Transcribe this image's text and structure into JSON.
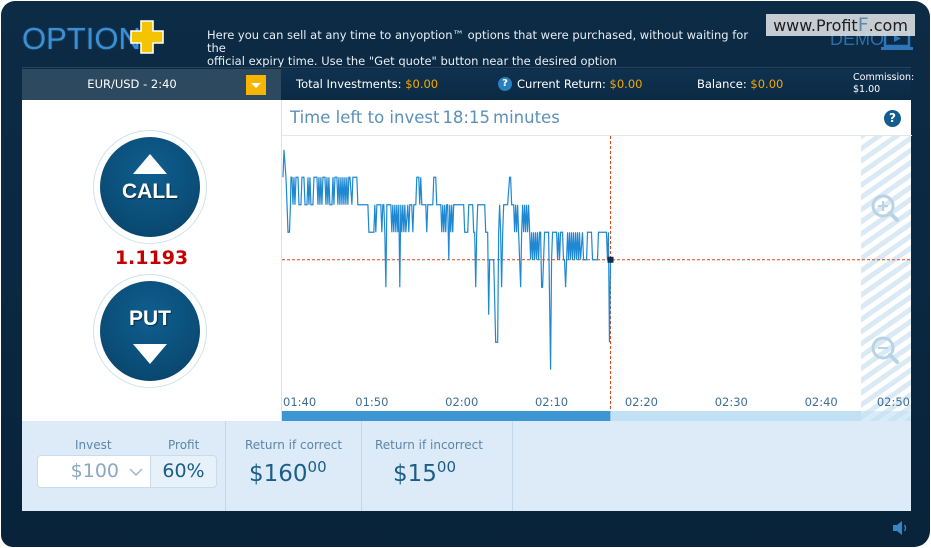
{
  "header": {
    "logo_text": "OPTION",
    "logo_icon": "plus-icon",
    "info_text_line1": "Here you can sell at any time to anyoption™ options that were purchased, without waiting for the",
    "info_text_line2": "official expiry time. Use the \"Get quote\" button near the desired option",
    "watermark_prefix": "www.Profit",
    "watermark_f": "F",
    "watermark_suffix": ".com",
    "demo_label": "DEMO",
    "demo_icon": "laptop-play-icon"
  },
  "toolbar": {
    "asset": "EUR/USD - 2:40",
    "asset_dropdown_icon": "chevron-down-icon",
    "total_investments_label": "Total Investments:",
    "total_investments_value": "$0.00",
    "current_return_help": "?",
    "current_return_label": "Current Return:",
    "current_return_value": "$0.00",
    "balance_label": "Balance:",
    "balance_value": "$0.00",
    "commission_label": "Commission:",
    "commission_value": "$1.00"
  },
  "trade": {
    "call_label": "CALL",
    "put_label": "PUT",
    "current_price": "1.1193"
  },
  "chart_panel": {
    "title_prefix": "Time left to invest",
    "time_left": "18:15",
    "title_suffix": "minutes",
    "help": "?",
    "zoom_in_icon": "zoom-in-icon",
    "zoom_out_icon": "zoom-out-icon"
  },
  "bottom": {
    "invest_label": "Invest",
    "profit_label": "Profit",
    "invest_value": "$100",
    "profit_value": "60%",
    "return_correct_label": "Return if correct",
    "return_correct_main": "$160",
    "return_correct_cents": "00",
    "return_incorrect_label": "Return if incorrect",
    "return_incorrect_main": "$15",
    "return_incorrect_cents": "00"
  },
  "footer": {
    "sound_icon": "speaker-icon"
  },
  "colors": {
    "frame": "#0b2a44",
    "accent_yellow": "#f7b400",
    "value_orange": "#f7a800",
    "price_red": "#c40000",
    "line_blue": "#1f88d2",
    "marker_red": "#d9441c",
    "progress_fill": "#3d96d3",
    "progress_rest": "#c2e0f4"
  },
  "chart_data": {
    "type": "line",
    "title": "Time left to invest 18:15 minutes",
    "xlabel": "",
    "ylabel": "",
    "x_unit": "minutes since 01:40",
    "xlim": [
      0,
      70
    ],
    "ylim": [
      1.11875,
      1.11975
    ],
    "grid": false,
    "x_ticks": [
      {
        "x": 0,
        "label": "01:40"
      },
      {
        "x": 10,
        "label": "01:50"
      },
      {
        "x": 20,
        "label": "02:00"
      },
      {
        "x": 30,
        "label": "02:10"
      },
      {
        "x": 40,
        "label": "02:20"
      },
      {
        "x": 50,
        "label": "02:30"
      },
      {
        "x": 60,
        "label": "02:40"
      },
      {
        "x": 70,
        "label": "02:50"
      }
    ],
    "current_time_x": 36.56,
    "current_price": 1.1193,
    "closed_zone_from_x": 64.44,
    "elapsed_fraction": 0.522,
    "series": [
      {
        "name": "EUR/USD",
        "points": [
          [
            0.11,
            1.1196
          ],
          [
            0.22,
            1.1197
          ],
          [
            0.44,
            1.1196
          ],
          [
            0.56,
            1.1195
          ],
          [
            0.67,
            1.1194
          ],
          [
            0.83,
            1.1194
          ],
          [
            0.94,
            1.1195
          ],
          [
            1.0,
            1.1196
          ],
          [
            1.11,
            1.1196
          ],
          [
            1.22,
            1.1195
          ],
          [
            1.33,
            1.1196
          ],
          [
            1.44,
            1.1195
          ],
          [
            1.56,
            1.1196
          ],
          [
            1.78,
            1.1196
          ],
          [
            1.89,
            1.1195
          ],
          [
            2.11,
            1.1195
          ],
          [
            2.22,
            1.1196
          ],
          [
            2.44,
            1.1196
          ],
          [
            2.56,
            1.1195
          ],
          [
            2.78,
            1.1195
          ],
          [
            2.89,
            1.1196
          ],
          [
            3.0,
            1.1195
          ],
          [
            3.11,
            1.1196
          ],
          [
            3.22,
            1.1195
          ],
          [
            3.44,
            1.1195
          ],
          [
            3.56,
            1.1196
          ],
          [
            3.89,
            1.1196
          ],
          [
            4.0,
            1.1195
          ],
          [
            4.11,
            1.1196
          ],
          [
            4.22,
            1.1195
          ],
          [
            4.33,
            1.1196
          ],
          [
            4.44,
            1.1195
          ],
          [
            4.56,
            1.1196
          ],
          [
            4.78,
            1.1196
          ],
          [
            4.89,
            1.1195
          ],
          [
            5.0,
            1.1196
          ],
          [
            5.11,
            1.1195
          ],
          [
            5.22,
            1.1196
          ],
          [
            5.33,
            1.1195
          ],
          [
            5.56,
            1.1195
          ],
          [
            5.67,
            1.1196
          ],
          [
            5.78,
            1.1195
          ],
          [
            5.89,
            1.1196
          ],
          [
            6.11,
            1.1196
          ],
          [
            6.22,
            1.1195
          ],
          [
            6.33,
            1.1196
          ],
          [
            6.44,
            1.1195
          ],
          [
            6.56,
            1.1196
          ],
          [
            6.67,
            1.1195
          ],
          [
            6.78,
            1.1196
          ],
          [
            6.89,
            1.1195
          ],
          [
            7.0,
            1.1196
          ],
          [
            7.11,
            1.1195
          ],
          [
            7.22,
            1.1196
          ],
          [
            7.33,
            1.1195
          ],
          [
            7.44,
            1.1196
          ],
          [
            7.56,
            1.1196
          ],
          [
            7.78,
            1.1195
          ],
          [
            7.89,
            1.1196
          ],
          [
            8.0,
            1.1196
          ],
          [
            8.33,
            1.1196
          ],
          [
            8.44,
            1.1195
          ],
          [
            9.56,
            1.1195
          ],
          [
            9.67,
            1.1194
          ],
          [
            10.22,
            1.1194
          ],
          [
            10.33,
            1.1195
          ],
          [
            10.44,
            1.1194
          ],
          [
            10.56,
            1.1195
          ],
          [
            10.67,
            1.1195
          ],
          [
            11.0,
            1.1195
          ],
          [
            11.11,
            1.1194
          ],
          [
            11.22,
            1.1195
          ],
          [
            11.33,
            1.1195
          ],
          [
            11.44,
            1.1194
          ],
          [
            11.56,
            1.1192
          ],
          [
            11.67,
            1.1195
          ],
          [
            12.11,
            1.1195
          ],
          [
            12.22,
            1.1194
          ],
          [
            12.33,
            1.1195
          ],
          [
            12.44,
            1.1194
          ],
          [
            12.56,
            1.1195
          ],
          [
            12.67,
            1.1194
          ],
          [
            12.78,
            1.1195
          ],
          [
            12.89,
            1.1194
          ],
          [
            13.0,
            1.1195
          ],
          [
            13.11,
            1.1192
          ],
          [
            13.22,
            1.1195
          ],
          [
            13.33,
            1.1194
          ],
          [
            13.44,
            1.1195
          ],
          [
            13.56,
            1.1194
          ],
          [
            13.67,
            1.1195
          ],
          [
            13.78,
            1.1194
          ],
          [
            14.0,
            1.1195
          ],
          [
            14.11,
            1.1194
          ],
          [
            14.22,
            1.1195
          ],
          [
            14.44,
            1.1195
          ],
          [
            14.56,
            1.1194
          ],
          [
            14.67,
            1.1195
          ],
          [
            14.89,
            1.1195
          ],
          [
            15.0,
            1.1196
          ],
          [
            15.22,
            1.1196
          ],
          [
            15.33,
            1.1195
          ],
          [
            15.44,
            1.1196
          ],
          [
            15.56,
            1.1195
          ],
          [
            16.0,
            1.1195
          ],
          [
            16.11,
            1.1194
          ],
          [
            16.22,
            1.1195
          ],
          [
            16.78,
            1.1195
          ],
          [
            16.89,
            1.1196
          ],
          [
            17.11,
            1.1196
          ],
          [
            17.22,
            1.1195
          ],
          [
            17.67,
            1.1195
          ],
          [
            17.78,
            1.1194
          ],
          [
            17.89,
            1.1195
          ],
          [
            18.0,
            1.1194
          ],
          [
            18.11,
            1.1195
          ],
          [
            18.22,
            1.1194
          ],
          [
            18.33,
            1.1195
          ],
          [
            18.44,
            1.1195
          ],
          [
            18.56,
            1.1193
          ],
          [
            18.67,
            1.1195
          ],
          [
            18.78,
            1.1194
          ],
          [
            18.89,
            1.1195
          ],
          [
            19.0,
            1.1194
          ],
          [
            19.11,
            1.1195
          ],
          [
            20.22,
            1.1195
          ],
          [
            20.33,
            1.1194
          ],
          [
            20.67,
            1.1194
          ],
          [
            20.78,
            1.1195
          ],
          [
            21.22,
            1.1195
          ],
          [
            21.33,
            1.1194
          ],
          [
            21.44,
            1.1194
          ],
          [
            21.56,
            1.1192
          ],
          [
            21.67,
            1.1194
          ],
          [
            21.78,
            1.1195
          ],
          [
            22.56,
            1.1195
          ],
          [
            22.67,
            1.1194
          ],
          [
            22.89,
            1.1194
          ],
          [
            23.0,
            1.1191
          ],
          [
            23.11,
            1.1193
          ],
          [
            23.56,
            1.1193
          ],
          [
            23.78,
            1.119
          ],
          [
            24.0,
            1.119
          ],
          [
            24.11,
            1.1194
          ],
          [
            24.22,
            1.1195
          ],
          [
            24.33,
            1.1194
          ],
          [
            24.44,
            1.1192
          ],
          [
            24.56,
            1.1194
          ],
          [
            24.67,
            1.1195
          ],
          [
            25.11,
            1.1195
          ],
          [
            25.33,
            1.1196
          ],
          [
            25.44,
            1.1196
          ],
          [
            25.56,
            1.1195
          ],
          [
            25.78,
            1.1195
          ],
          [
            25.89,
            1.1194
          ],
          [
            26.0,
            1.1195
          ],
          [
            26.11,
            1.1194
          ],
          [
            26.22,
            1.1195
          ],
          [
            26.33,
            1.1194
          ],
          [
            26.56,
            1.1192
          ],
          [
            26.67,
            1.1194
          ],
          [
            26.78,
            1.1195
          ],
          [
            26.89,
            1.1194
          ],
          [
            27.0,
            1.1195
          ],
          [
            27.11,
            1.1194
          ],
          [
            27.22,
            1.1195
          ],
          [
            27.33,
            1.1194
          ],
          [
            27.44,
            1.1195
          ],
          [
            27.56,
            1.1194
          ],
          [
            27.67,
            1.1193
          ],
          [
            27.78,
            1.1194
          ],
          [
            27.89,
            1.1193
          ],
          [
            28.0,
            1.1194
          ],
          [
            28.11,
            1.1193
          ],
          [
            28.22,
            1.1194
          ],
          [
            28.33,
            1.1193
          ],
          [
            28.44,
            1.1194
          ],
          [
            28.56,
            1.1193
          ],
          [
            28.67,
            1.1194
          ],
          [
            28.78,
            1.1194
          ],
          [
            28.89,
            1.1192
          ],
          [
            29.0,
            1.1192
          ],
          [
            29.11,
            1.1193
          ],
          [
            29.22,
            1.1194
          ],
          [
            29.67,
            1.1194
          ],
          [
            29.89,
            1.1189
          ],
          [
            30.0,
            1.1193
          ],
          [
            30.11,
            1.1194
          ],
          [
            30.56,
            1.1194
          ],
          [
            30.67,
            1.1193
          ],
          [
            30.78,
            1.1194
          ],
          [
            30.89,
            1.1193
          ],
          [
            31.0,
            1.1194
          ],
          [
            31.22,
            1.1194
          ],
          [
            31.33,
            1.1193
          ],
          [
            31.44,
            1.1193
          ],
          [
            31.56,
            1.1192
          ],
          [
            31.67,
            1.1193
          ],
          [
            31.78,
            1.1194
          ],
          [
            31.89,
            1.1193
          ],
          [
            32.0,
            1.1194
          ],
          [
            32.11,
            1.1193
          ],
          [
            32.22,
            1.1194
          ],
          [
            32.33,
            1.1193
          ],
          [
            32.44,
            1.1194
          ],
          [
            32.56,
            1.1193
          ],
          [
            32.67,
            1.1194
          ],
          [
            32.78,
            1.1193
          ],
          [
            32.89,
            1.1194
          ],
          [
            33.0,
            1.1193
          ],
          [
            33.11,
            1.1194
          ],
          [
            33.22,
            1.1193
          ],
          [
            33.44,
            1.1194
          ],
          [
            33.56,
            1.1193
          ],
          [
            33.89,
            1.1193
          ],
          [
            34.0,
            1.1194
          ],
          [
            34.44,
            1.1194
          ],
          [
            34.56,
            1.1193
          ],
          [
            35.11,
            1.1193
          ],
          [
            35.22,
            1.1194
          ],
          [
            36.11,
            1.1194
          ],
          [
            36.22,
            1.1193
          ],
          [
            36.33,
            1.1194
          ],
          [
            36.44,
            1.119
          ],
          [
            36.56,
            1.1193
          ]
        ]
      }
    ]
  }
}
